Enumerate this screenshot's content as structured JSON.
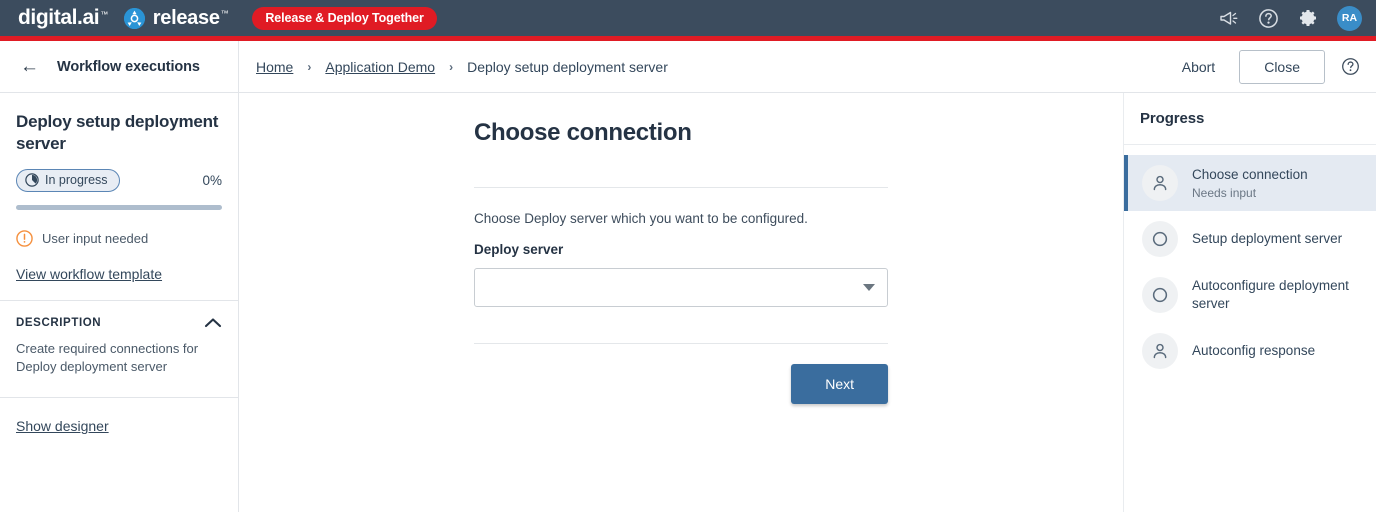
{
  "topbar": {
    "brand_primary": "digital.ai",
    "brand_tm": "™",
    "brand_secondary": "release",
    "tagline": "Release & Deploy Together",
    "icons": [
      "megaphone-icon",
      "help-circle-icon",
      "gear-icon"
    ],
    "avatar_initials": "RA",
    "accent_red": "#e01b24",
    "bar_color": "#3c4c5e",
    "avatar_color": "#3a8dc8"
  },
  "subheader": {
    "back_label": "Workflow executions",
    "breadcrumbs": [
      {
        "label": "Home",
        "link": true
      },
      {
        "label": "Application Demo",
        "link": true
      },
      {
        "label": "Deploy setup deployment server",
        "link": false
      }
    ],
    "separator": "›",
    "abort_label": "Abort",
    "close_label": "Close"
  },
  "left_panel": {
    "title": "Deploy setup deployment server",
    "status_badge": "In progress",
    "percent": "0%",
    "progress_value": 0,
    "input_needed": "User input needed",
    "template_link": "View workflow template",
    "description_heading": "DESCRIPTION",
    "description_body": "Create required connections for Deploy deployment server",
    "designer_link": "Show designer"
  },
  "main": {
    "title": "Choose connection",
    "description": "Choose Deploy server which you want to be configured.",
    "field_label": "Deploy server",
    "field_value": "",
    "field_placeholder": "",
    "next_label": "Next",
    "button_color": "#3a6d9e"
  },
  "progress_panel": {
    "title": "Progress",
    "items": [
      {
        "label": "Choose connection",
        "sub": "Needs input",
        "icon": "user-icon",
        "active": true
      },
      {
        "label": "Setup deployment server",
        "sub": "",
        "icon": "circle-icon",
        "active": false
      },
      {
        "label": "Autoconfigure deployment server",
        "sub": "",
        "icon": "circle-icon",
        "active": false
      },
      {
        "label": "Autoconfig response",
        "sub": "",
        "icon": "user-icon",
        "active": false
      }
    ]
  }
}
